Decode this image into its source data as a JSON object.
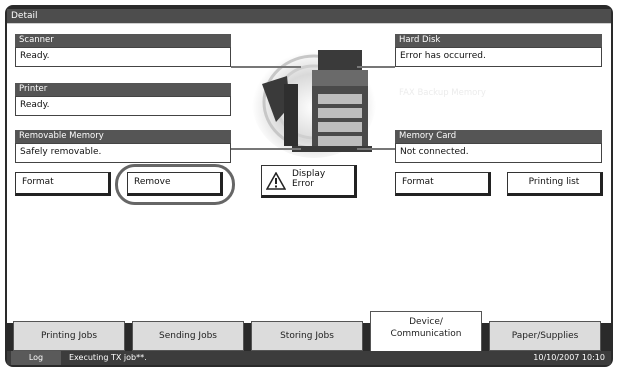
{
  "window": {
    "title": "Detail"
  },
  "left_panels": [
    {
      "label": "Scanner",
      "status": "Ready."
    },
    {
      "label": "Printer",
      "status": "Ready."
    },
    {
      "label": "Removable Memory",
      "status": "Safely removable."
    }
  ],
  "right_panels": {
    "hard_disk": {
      "label": "Hard Disk",
      "status": "Error has occurred."
    },
    "fax_backup_label": "FAX Backup Memory",
    "memory_card": {
      "label": "Memory Card",
      "status": "Not connected."
    }
  },
  "buttons": {
    "removable_format": "Format",
    "remove": "Remove",
    "display_error_line1": "Display",
    "display_error_line2": "Error",
    "memorycard_format": "Format",
    "printing_list": "Printing list"
  },
  "tabs": [
    {
      "label": "Printing Jobs"
    },
    {
      "label": "Sending Jobs"
    },
    {
      "label": "Storing Jobs"
    },
    {
      "label_line1": "Device/",
      "label_line2": "Communication"
    },
    {
      "label": "Paper/Supplies"
    }
  ],
  "status_bar": {
    "log": "Log",
    "message": "Executing TX job**.",
    "datetime": "10/10/2007  10:10"
  },
  "icons": [
    "warning-icon",
    "printer-illustration"
  ],
  "colors": {
    "title_bar": "#4d4d4d",
    "panel_header": "#555555",
    "bezel": "#2a2a2a"
  }
}
